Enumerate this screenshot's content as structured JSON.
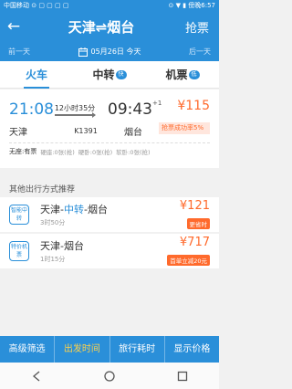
{
  "status": {
    "left": "中国移动 ⊙ ▢ ▢ ▢ ▢",
    "right": "⊙ ▼ ▮ 傍晚6:57"
  },
  "header": {
    "title": "天津⇌烟台",
    "grab": "抢票"
  },
  "datebar": {
    "prev": "前一天",
    "date": "05月26日 今天",
    "next": "后一天"
  },
  "tabs": [
    {
      "label": "火车",
      "badge": ""
    },
    {
      "label": "中转",
      "badge": "快"
    },
    {
      "label": "机票",
      "badge": "低"
    }
  ],
  "train": {
    "dep_time": "21:08",
    "duration": "12小时35分",
    "arr_time": "09:43",
    "plus_day": "+1",
    "price": "¥115",
    "grab_rate": "抢票成功率5%",
    "from": "天津",
    "train_no": "K1391",
    "to": "烟台",
    "seats": [
      {
        "label": "无座:有票",
        "style": "hl"
      },
      {
        "label": "硬座:0张(抢)",
        "style": ""
      },
      {
        "label": "硬卧:0张(抢)",
        "style": ""
      },
      {
        "label": "软卧:0张(抢)",
        "style": ""
      }
    ]
  },
  "section_title": "其他出行方式推荐",
  "options": [
    {
      "icon": "智能中转",
      "route_a": "天津-",
      "route_mid": "中转",
      "route_b": "-烟台",
      "duration": "3时50分",
      "price": "¥121",
      "tag": "更省时"
    },
    {
      "icon": "特价机票",
      "route_a": "天津-烟台",
      "route_mid": "",
      "route_b": "",
      "duration": "1时15分",
      "price": "¥717",
      "tag": "首单立减20元"
    }
  ],
  "bottom_bar": [
    {
      "label": "高级筛选",
      "active": false
    },
    {
      "label": "出发时间",
      "active": true
    },
    {
      "label": "旅行耗时",
      "active": false
    },
    {
      "label": "显示价格",
      "active": false
    }
  ],
  "colors": {
    "primary": "#2a8fd9",
    "accent": "#ff6a2c",
    "highlight": "#ffd24a"
  }
}
